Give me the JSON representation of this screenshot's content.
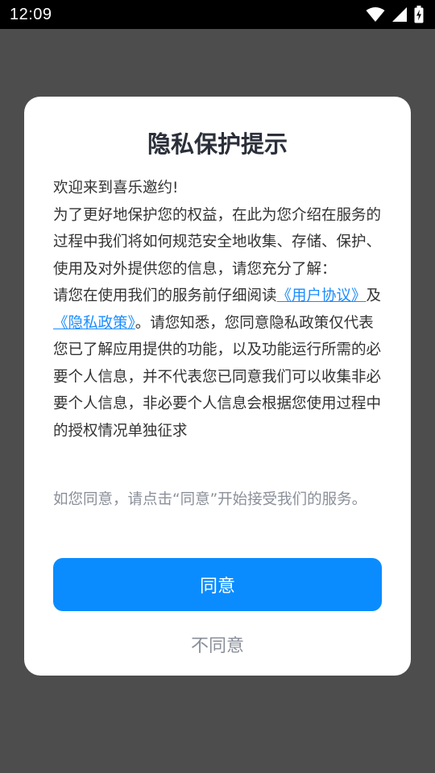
{
  "status_bar": {
    "time": "12:09",
    "icons": [
      "wifi-icon",
      "signal-icon",
      "battery-charging-icon"
    ]
  },
  "dialog": {
    "title": "隐私保护提示",
    "greeting": "欢迎来到喜乐邀约!",
    "paragraph_1": "为了更好地保护您的权益，在此为您介绍在服务的过程中我们将如何规范安全地收集、存储、保护、使用及对外提供您的信息，请您充分了解：",
    "paragraph_2_prefix": "请您在使用我们的服务前仔细阅读",
    "user_agreement_link": "《用户协议》",
    "and_text": "及",
    "privacy_policy_link": "《隐私政策》",
    "paragraph_2_suffix": "。请您知悉，您同意隐私政策仅代表您已了解应用提供的功能，以及功能运行所需的必要个人信息，并不代表您已同意我们可以收集非必要个人信息，非必要个人信息会根据您使用过程中的授权情况单独征求",
    "consent_note": "如您同意，请点击“同意”开始接受我们的服务。",
    "agree_label": "同意",
    "disagree_label": "不同意"
  },
  "colors": {
    "accent": "#0a8cff",
    "link": "#1a8cff",
    "overlay": "#4d4d4d",
    "secondary_text": "#8a8f99"
  }
}
